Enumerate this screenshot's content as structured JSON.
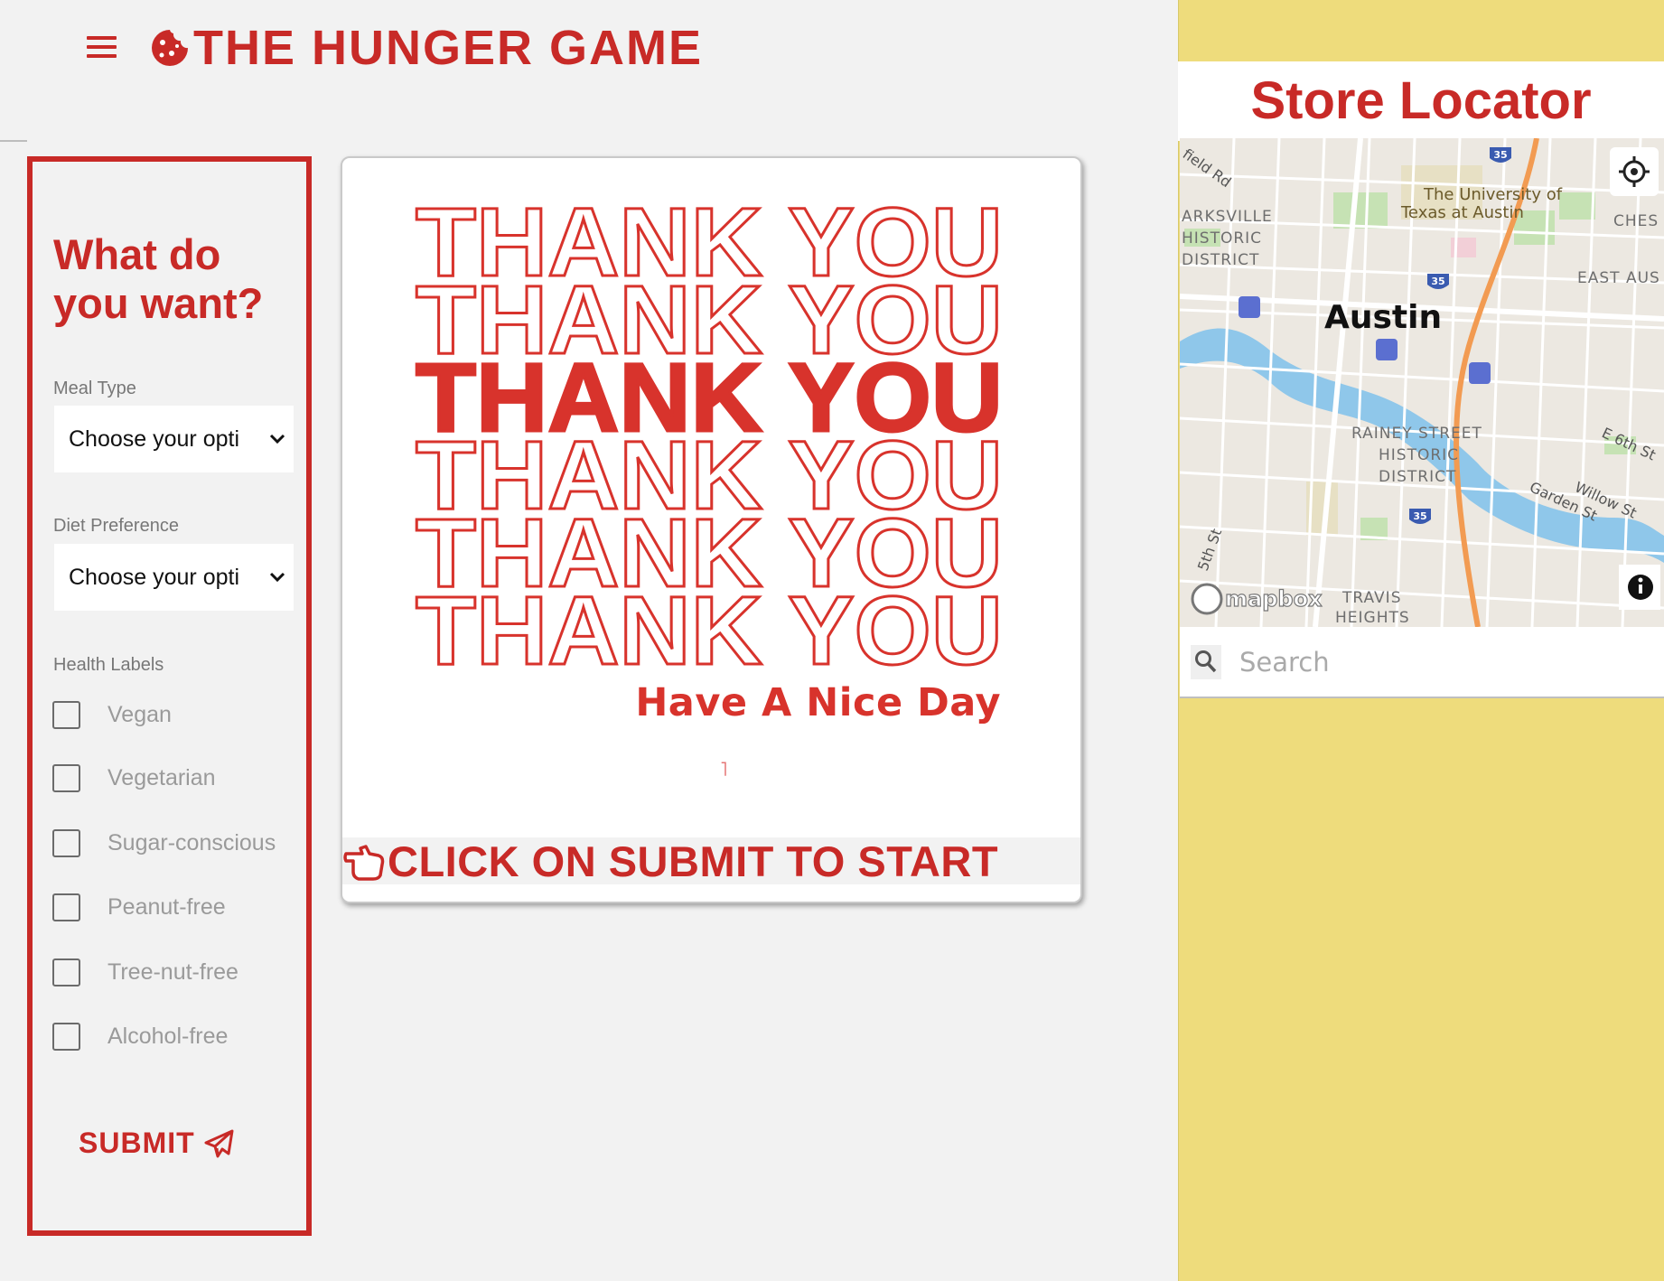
{
  "header": {
    "brand_title": "THE HUNGER GAME",
    "menu_icon": "hamburger-menu-icon",
    "brand_icon": "cookie-icon"
  },
  "sidebar": {
    "question": "What do you want?",
    "meal_type": {
      "label": "Meal Type",
      "selected": "Choose your opti"
    },
    "diet_preference": {
      "label": "Diet Preference",
      "selected": "Choose your opti"
    },
    "health_labels": {
      "label": "Health Labels",
      "options": [
        "Vegan",
        "Vegetarian",
        "Sugar-conscious",
        "Peanut-free",
        "Tree-nut-free",
        "Alcohol-free"
      ]
    },
    "submit_label": "SUBMIT",
    "submit_icon": "paper-plane-icon"
  },
  "card": {
    "thank_you_text": "THANK YOU",
    "nice_day": "Have A Nice Day",
    "tick": "˥",
    "banner_text": "CLICK ON SUBMIT TO START",
    "banner_icon": "pointing-hand-icon"
  },
  "locator": {
    "title": "Store Locator",
    "search_placeholder": "Search",
    "map_labels": {
      "city": "Austin",
      "university": "The University of Texas at Austin",
      "district_1": "CLARKSVILLE HISTORIC DISTRICT",
      "district_2": "RAINEY STREET HISTORIC DISTRICT",
      "travis": "TRAVIS HEIGHTS",
      "east": "EAST AUS",
      "ches": "CHES",
      "field_rd": "field Rd",
      "e6th": "E 6th St",
      "willow": "Willow St",
      "garden": "Garden St",
      "fifth": "5th St",
      "interstate": "35",
      "mapbox": "mapbox"
    }
  },
  "colors": {
    "accent": "#c82a27",
    "panel_yellow": "#eedc7c",
    "background": "#f2f2f2"
  }
}
